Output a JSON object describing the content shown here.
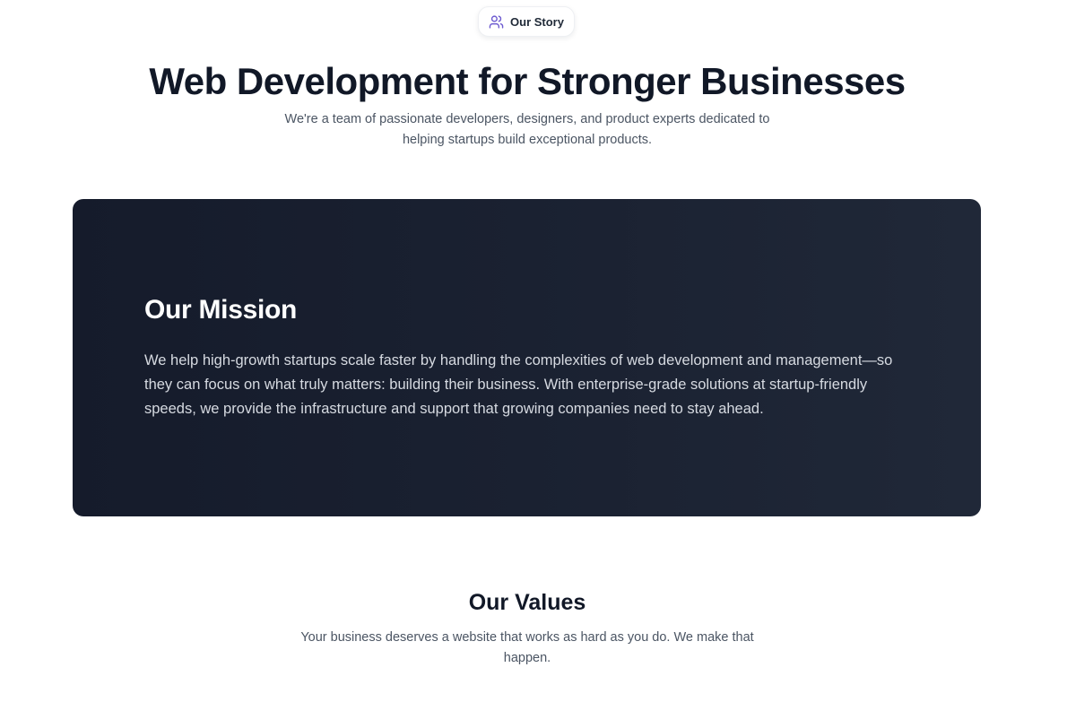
{
  "badge": {
    "icon": "users-icon",
    "label": "Our Story"
  },
  "hero": {
    "title": "Web Development for Stronger Businesses",
    "subtitle": "We're a team of passionate developers, designers, and product experts dedicated to helping startups build exceptional products."
  },
  "mission": {
    "title": "Our Mission",
    "text": "We help high-growth startups scale faster by handling the complexities of web development and management—so they can focus on what truly matters: building their business. With enterprise-grade solutions at startup-friendly speeds, we provide the infrastructure and support that growing companies need to stay ahead."
  },
  "values": {
    "title": "Our Values",
    "subtitle": "Your business deserves a website that works as hard as you do. We make that happen."
  },
  "colors": {
    "heading": "#111827",
    "body_text": "#4b5563",
    "mission_bg": "#1a2131",
    "icon_accent": "#6d5bd0"
  }
}
